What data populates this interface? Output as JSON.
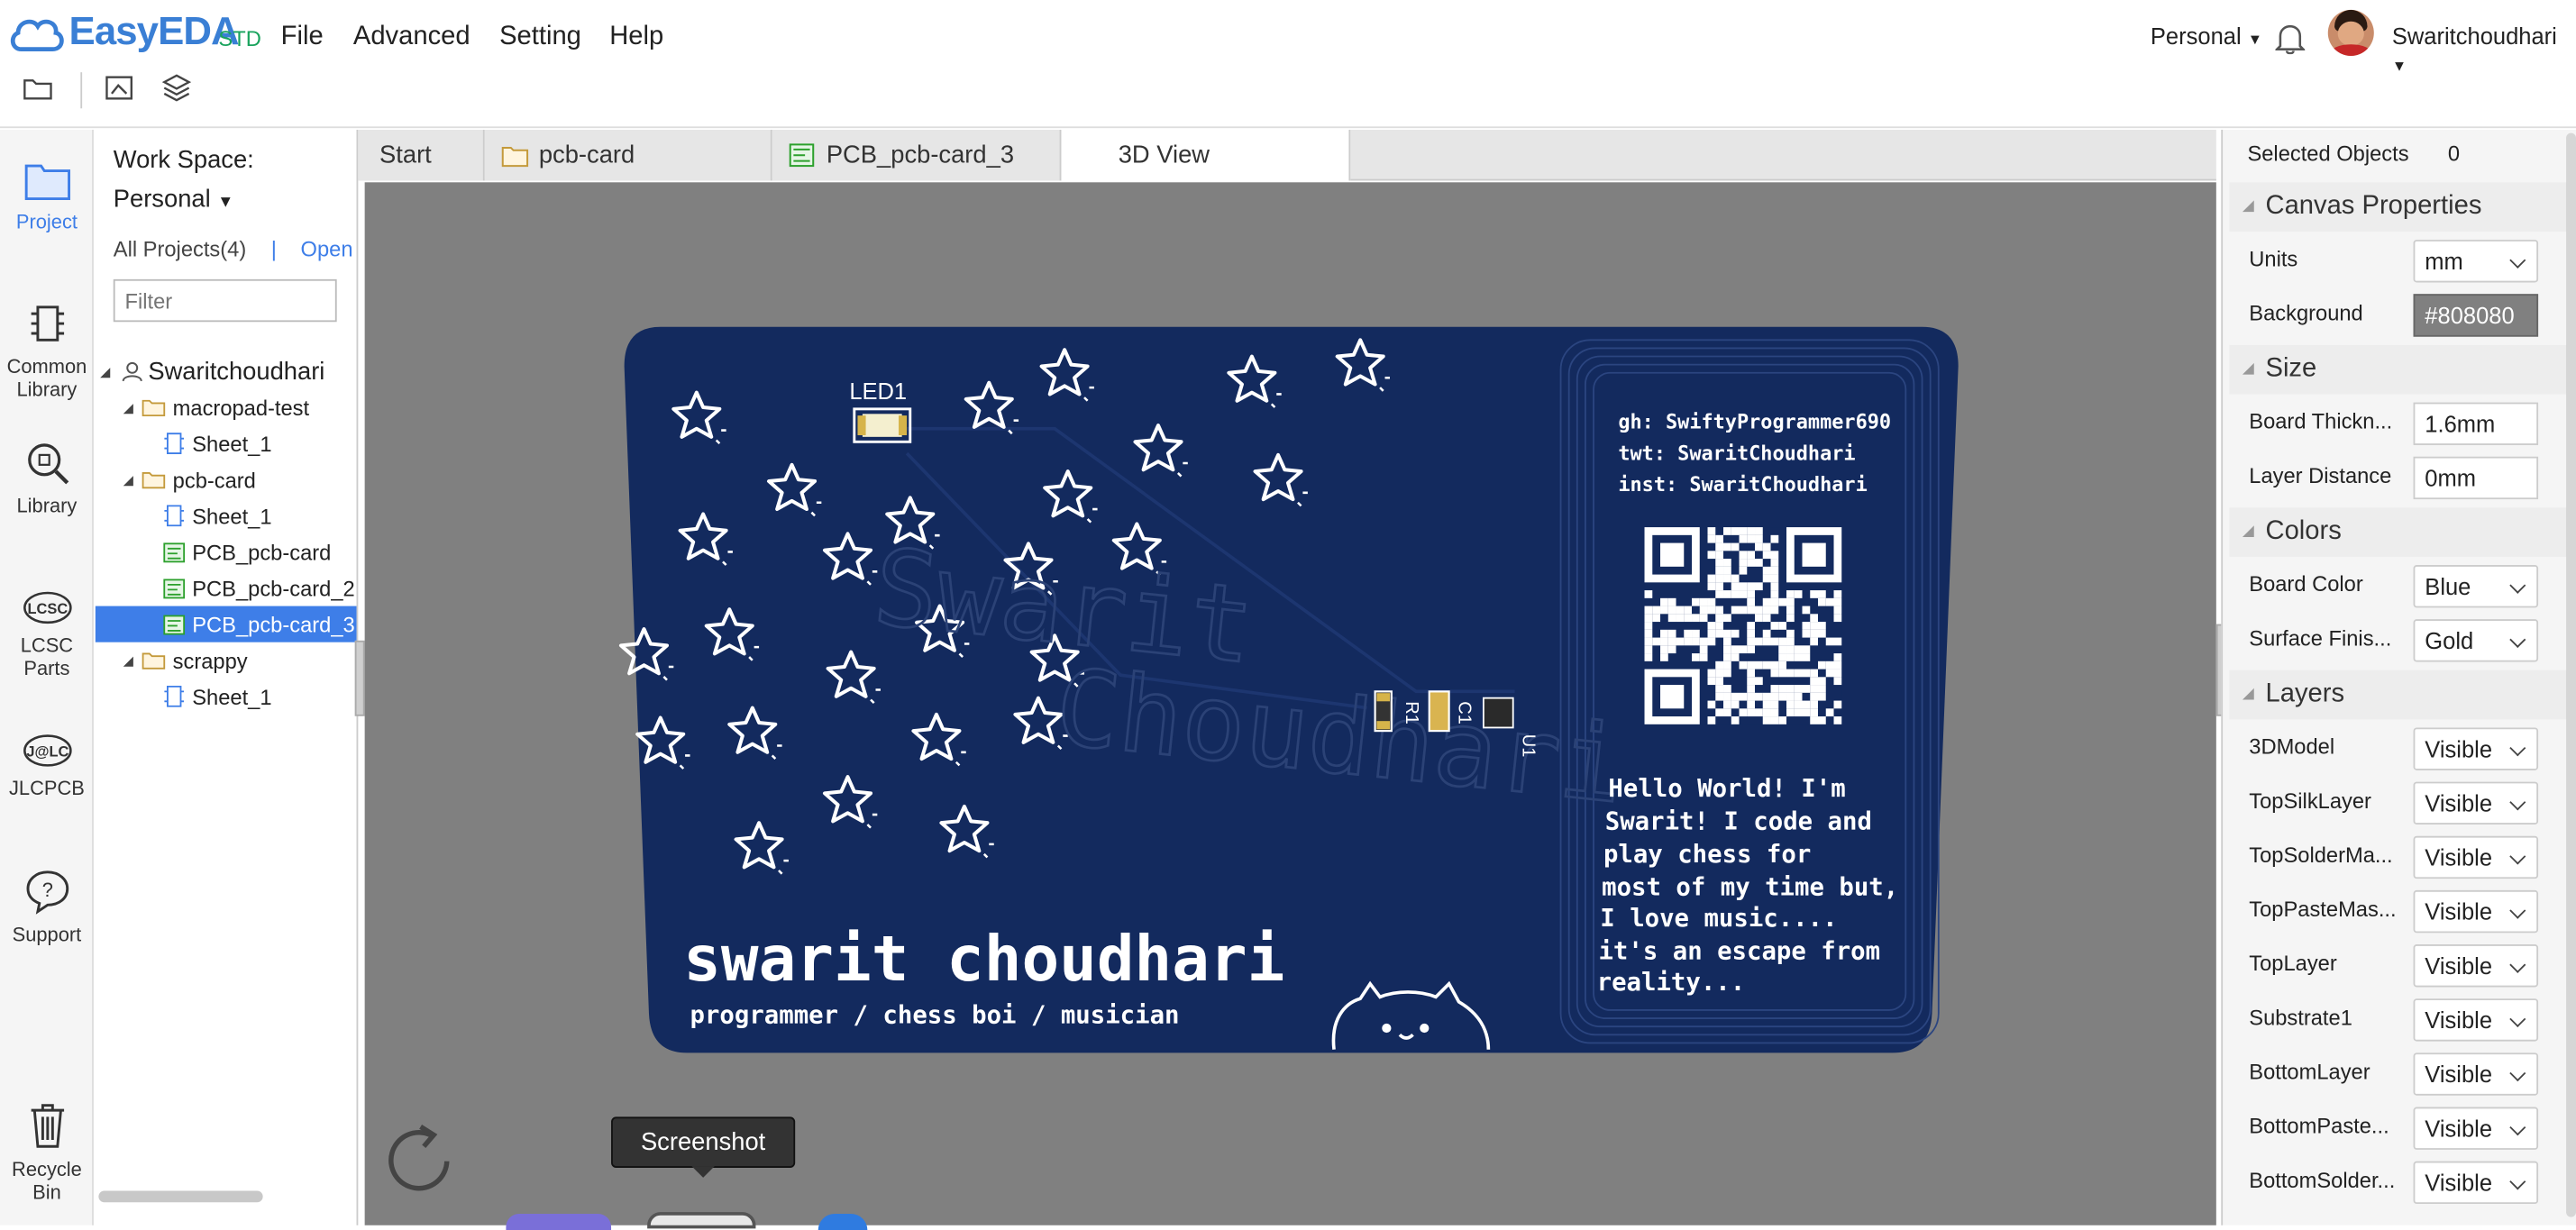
{
  "app": {
    "logo": "EasyEDA",
    "edition": "STD"
  },
  "menu": {
    "file": "File",
    "advanced": "Advanced",
    "setting": "Setting",
    "help": "Help"
  },
  "account": {
    "workspace": "Personal",
    "username": "Swaritchoudhari"
  },
  "sidebar": {
    "project": "Project",
    "common_library_1": "Common",
    "common_library_2": "Library",
    "library": "Library",
    "lcsc_1": "LCSC",
    "lcsc_2": "Parts",
    "jlcpcb": "JLCPCB",
    "support": "Support",
    "recycle_1": "Recycle",
    "recycle_2": "Bin"
  },
  "project_panel": {
    "workspace_label": "Work Space:",
    "workspace_value": "Personal",
    "all_projects": "All Projects(4)",
    "separator": "|",
    "open": "Open",
    "filter_placeholder": "Filter",
    "tree": {
      "root": "Swaritchoudhari",
      "p1": "macropad-test",
      "p1_sheet": "Sheet_1",
      "p2": "pcb-card",
      "p2_sheet": "Sheet_1",
      "p2_pcb1": "PCB_pcb-card",
      "p2_pcb2": "PCB_pcb-card_2",
      "p2_pcb3": "PCB_pcb-card_3",
      "p3": "scrappy",
      "p3_sheet": "Sheet_1"
    }
  },
  "tabs": {
    "start": "Start",
    "pcb_card": "pcb-card",
    "pcb3": "PCB_pcb-card_3",
    "view3d": "3D View"
  },
  "board": {
    "led_label": "LED1",
    "r1": "R1",
    "c1": "C1",
    "u1": "U1",
    "watermark_1": "Swarit",
    "watermark_2": "Choudhari",
    "handle_gh": "gh: SwiftyProgrammer690",
    "handle_twt": "twt: SwaritChoudhari",
    "handle_inst": "inst: SwaritChoudhari",
    "bio_1": "Hello World! I'm",
    "bio_2": "Swarit! I code and",
    "bio_3": "play chess for",
    "bio_4": "most of my time but,",
    "bio_5": "I love music....",
    "bio_6": "it's an escape from",
    "bio_7": "reality...",
    "name": "swarit choudhari",
    "tagline": "programmer / chess boi / musician",
    "board_color": "#132a5e",
    "silk_color": "#ffffff"
  },
  "tooltip": {
    "screenshot": "Screenshot"
  },
  "properties": {
    "selected_label": "Selected Objects",
    "selected_count": "0",
    "canvas_section": "Canvas Properties",
    "units_label": "Units",
    "units_value": "mm",
    "background_label": "Background",
    "background_value": "#808080",
    "size_section": "Size",
    "thickness_label": "Board Thickn...",
    "thickness_value": "1.6mm",
    "distance_label": "Layer Distance",
    "distance_value": "0mm",
    "colors_section": "Colors",
    "board_color_label": "Board Color",
    "board_color_value": "Blue",
    "finish_label": "Surface Finis...",
    "finish_value": "Gold",
    "layers_section": "Layers",
    "layers": [
      {
        "name": "3DModel",
        "value": "Visible"
      },
      {
        "name": "TopSilkLayer",
        "value": "Visible"
      },
      {
        "name": "TopSolderMa...",
        "value": "Visible"
      },
      {
        "name": "TopPasteMas...",
        "value": "Visible"
      },
      {
        "name": "TopLayer",
        "value": "Visible"
      },
      {
        "name": "Substrate1",
        "value": "Visible"
      },
      {
        "name": "BottomLayer",
        "value": "Visible"
      },
      {
        "name": "BottomPaste...",
        "value": "Visible"
      },
      {
        "name": "BottomSolder...",
        "value": "Visible"
      }
    ]
  }
}
